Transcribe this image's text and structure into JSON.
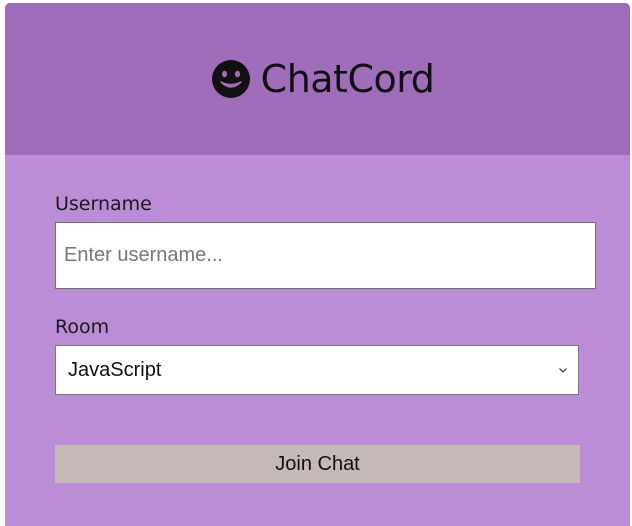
{
  "header": {
    "title": "ChatCord",
    "icon": "smile-icon"
  },
  "form": {
    "username_label": "Username",
    "username_placeholder": "Enter username...",
    "username_value": "",
    "room_label": "Room",
    "room_selected": "JavaScript",
    "submit_label": "Join Chat"
  },
  "colors": {
    "header_bg": "#a06dbb",
    "body_bg": "#bb8dd6",
    "button_bg": "#c4b9b7"
  }
}
